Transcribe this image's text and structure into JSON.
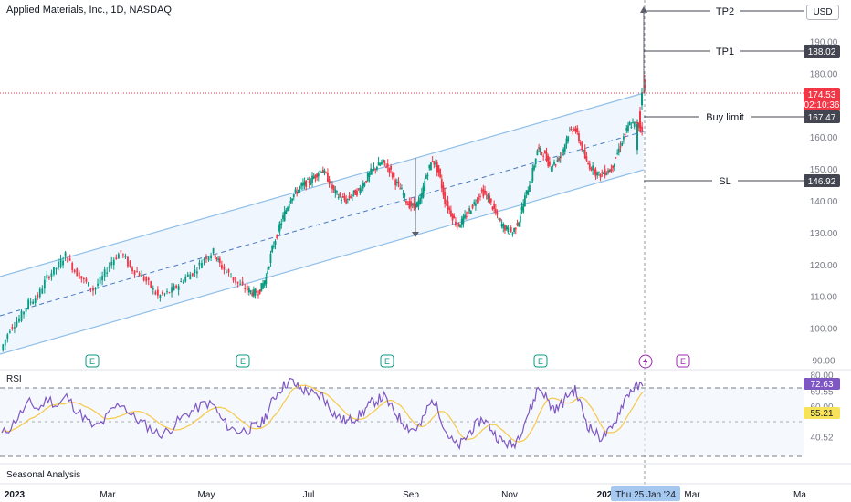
{
  "header": {
    "title": "Applied Materials, Inc., 1D, NASDAQ",
    "currency": "USD"
  },
  "chart_data": {
    "type": "candlestick",
    "symbol": "Applied Materials, Inc., 1D, NASDAQ",
    "y_ticks": [
      "90.00",
      "100.00",
      "110.00",
      "120.00",
      "130.00",
      "140.00",
      "150.00",
      "160.00",
      "170.00",
      "180.00",
      "190.00"
    ],
    "ylim": [
      87,
      203
    ],
    "x_ticks": [
      "2023",
      "Mar",
      "May",
      "Jul",
      "Sep",
      "Nov",
      "202",
      "Mar",
      "Ma"
    ],
    "crosshair_date": "Thu 25 Jan '24",
    "last_price": "174.53",
    "countdown": "02:10:36",
    "levels": [
      {
        "name": "TP2",
        "value": "",
        "label": "TP2"
      },
      {
        "name": "TP1",
        "value": "188.02",
        "label": "TP1"
      },
      {
        "name": "Buy limit",
        "value": "167.47",
        "label": "Buy limit"
      },
      {
        "name": "SL",
        "value": "146.92",
        "label": "SL"
      }
    ],
    "event_markers": [
      "E",
      "E",
      "E",
      "E",
      "E"
    ],
    "price_path": [
      [
        0,
        93
      ],
      [
        6,
        100
      ],
      [
        12,
        103
      ],
      [
        18,
        108
      ],
      [
        24,
        110
      ],
      [
        30,
        116
      ],
      [
        36,
        119
      ],
      [
        42,
        123
      ],
      [
        48,
        118
      ],
      [
        54,
        115
      ],
      [
        60,
        112
      ],
      [
        66,
        116
      ],
      [
        72,
        121
      ],
      [
        78,
        124
      ],
      [
        84,
        119
      ],
      [
        90,
        117
      ],
      [
        96,
        114
      ],
      [
        102,
        110
      ],
      [
        108,
        111
      ],
      [
        114,
        113
      ],
      [
        120,
        116
      ],
      [
        126,
        118
      ],
      [
        132,
        122
      ],
      [
        138,
        124
      ],
      [
        142,
        120
      ],
      [
        148,
        117
      ],
      [
        154,
        114
      ],
      [
        160,
        112
      ],
      [
        164,
        111
      ],
      [
        168,
        112
      ],
      [
        172,
        116
      ],
      [
        176,
        125
      ],
      [
        180,
        131
      ],
      [
        184,
        136
      ],
      [
        188,
        141
      ],
      [
        192,
        143
      ],
      [
        196,
        145
      ],
      [
        200,
        146
      ],
      [
        204,
        148
      ],
      [
        208,
        150
      ],
      [
        212,
        147
      ],
      [
        216,
        143
      ],
      [
        220,
        141
      ],
      [
        224,
        140
      ],
      [
        228,
        142
      ],
      [
        232,
        143
      ],
      [
        236,
        146
      ],
      [
        240,
        149
      ],
      [
        244,
        151
      ],
      [
        248,
        152
      ],
      [
        252,
        150
      ],
      [
        256,
        146
      ],
      [
        260,
        143
      ],
      [
        264,
        139
      ],
      [
        268,
        138
      ],
      [
        272,
        140
      ],
      [
        276,
        148
      ],
      [
        280,
        153
      ],
      [
        284,
        149
      ],
      [
        288,
        140
      ],
      [
        292,
        136
      ],
      [
        296,
        132
      ],
      [
        300,
        134
      ],
      [
        304,
        137
      ],
      [
        308,
        140
      ],
      [
        312,
        143
      ],
      [
        316,
        141
      ],
      [
        320,
        137
      ],
      [
        324,
        133
      ],
      [
        328,
        131
      ],
      [
        332,
        130
      ],
      [
        336,
        134
      ],
      [
        340,
        141
      ],
      [
        344,
        147
      ],
      [
        348,
        156
      ],
      [
        352,
        155
      ],
      [
        356,
        151
      ],
      [
        360,
        152
      ],
      [
        364,
        155
      ],
      [
        368,
        161
      ],
      [
        372,
        163
      ],
      [
        376,
        158
      ],
      [
        380,
        152
      ],
      [
        384,
        150
      ],
      [
        388,
        148
      ],
      [
        392,
        149
      ],
      [
        396,
        150
      ],
      [
        400,
        155
      ],
      [
        404,
        160
      ],
      [
        408,
        164
      ],
      [
        412,
        164
      ],
      [
        416,
        163
      ]
    ],
    "rsi": {
      "label": "RSI",
      "value": "72.63",
      "ma_value": "55.21",
      "ticks": [
        "80.00",
        "69.55",
        "60.00",
        "40.52"
      ],
      "ylim": [
        25,
        82
      ],
      "overbought": 70,
      "oversold": 30,
      "mid": 50,
      "path": [
        [
          0,
          42
        ],
        [
          6,
          47
        ],
        [
          12,
          55
        ],
        [
          18,
          62
        ],
        [
          24,
          58
        ],
        [
          30,
          65
        ],
        [
          36,
          60
        ],
        [
          42,
          66
        ],
        [
          48,
          58
        ],
        [
          54,
          52
        ],
        [
          60,
          46
        ],
        [
          66,
          50
        ],
        [
          72,
          58
        ],
        [
          78,
          62
        ],
        [
          84,
          54
        ],
        [
          90,
          50
        ],
        [
          96,
          46
        ],
        [
          102,
          42
        ],
        [
          108,
          44
        ],
        [
          114,
          50
        ],
        [
          120,
          55
        ],
        [
          126,
          58
        ],
        [
          132,
          62
        ],
        [
          138,
          60
        ],
        [
          142,
          52
        ],
        [
          148,
          46
        ],
        [
          154,
          44
        ],
        [
          160,
          45
        ],
        [
          164,
          47
        ],
        [
          168,
          48
        ],
        [
          172,
          55
        ],
        [
          176,
          64
        ],
        [
          180,
          70
        ],
        [
          184,
          74
        ],
        [
          188,
          76
        ],
        [
          192,
          72
        ],
        [
          196,
          70
        ],
        [
          200,
          69
        ],
        [
          204,
          66
        ],
        [
          208,
          67
        ],
        [
          212,
          60
        ],
        [
          216,
          55
        ],
        [
          220,
          52
        ],
        [
          224,
          50
        ],
        [
          228,
          52
        ],
        [
          232,
          54
        ],
        [
          236,
          58
        ],
        [
          240,
          62
        ],
        [
          244,
          64
        ],
        [
          248,
          66
        ],
        [
          252,
          60
        ],
        [
          256,
          55
        ],
        [
          260,
          50
        ],
        [
          264,
          46
        ],
        [
          268,
          45
        ],
        [
          272,
          48
        ],
        [
          276,
          58
        ],
        [
          280,
          64
        ],
        [
          284,
          56
        ],
        [
          288,
          44
        ],
        [
          292,
          38
        ],
        [
          296,
          34
        ],
        [
          300,
          38
        ],
        [
          304,
          44
        ],
        [
          308,
          48
        ],
        [
          312,
          52
        ],
        [
          316,
          48
        ],
        [
          320,
          42
        ],
        [
          324,
          38
        ],
        [
          328,
          36
        ],
        [
          332,
          35
        ],
        [
          336,
          42
        ],
        [
          340,
          52
        ],
        [
          344,
          60
        ],
        [
          348,
          72
        ],
        [
          352,
          68
        ],
        [
          356,
          60
        ],
        [
          360,
          58
        ],
        [
          364,
          62
        ],
        [
          368,
          68
        ],
        [
          372,
          70
        ],
        [
          376,
          60
        ],
        [
          380,
          48
        ],
        [
          384,
          44
        ],
        [
          388,
          40
        ],
        [
          392,
          42
        ],
        [
          396,
          45
        ],
        [
          400,
          55
        ],
        [
          404,
          64
        ],
        [
          408,
          70
        ],
        [
          412,
          72
        ],
        [
          416,
          72.6
        ]
      ]
    }
  },
  "footer": {
    "seasonal_label": "Seasonal Analysis"
  },
  "colors": {
    "up": "#089981",
    "down": "#f23645",
    "channel": "#90bfe9",
    "channel_fill": "#e8f2fd",
    "rsi_line": "#7e57c2",
    "rsi_ma": "#f7c948",
    "label_bg": "#131722",
    "rsi_badge": "#7e57c2",
    "ma_badge": "#f7e35a",
    "last_badge": "#f23645",
    "date_badge": "#a4c8ef"
  }
}
